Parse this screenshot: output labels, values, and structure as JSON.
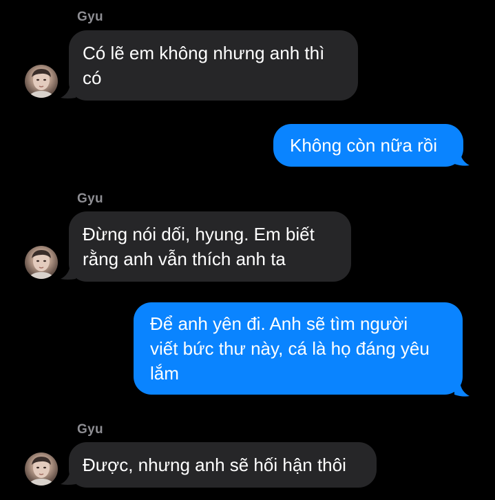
{
  "conversation": {
    "messages": [
      {
        "sender": "Gyu",
        "direction": "incoming",
        "text": "Có lẽ em không nhưng anh thì\ncó"
      },
      {
        "sender": "",
        "direction": "outgoing",
        "text": "Không còn nữa rồi"
      },
      {
        "sender": "Gyu",
        "direction": "incoming",
        "text": "Đừng nói dối, hyung. Em biết\nrằng anh vẫn thích anh ta"
      },
      {
        "sender": "",
        "direction": "outgoing",
        "text": "Để anh yên đi. Anh sẽ tìm người\nviết bức thư này, cá là họ đáng yêu\nlắm"
      },
      {
        "sender": "Gyu",
        "direction": "incoming",
        "text": "Được, nhưng anh sẽ hối hận thôi"
      }
    ]
  },
  "colors": {
    "background": "#000000",
    "incoming_bubble": "#262628",
    "outgoing_bubble": "#0a84ff",
    "sender_name": "#8e8e93",
    "text": "#ffffff"
  },
  "icons": {
    "avatar": "contact-photo-avatar"
  }
}
